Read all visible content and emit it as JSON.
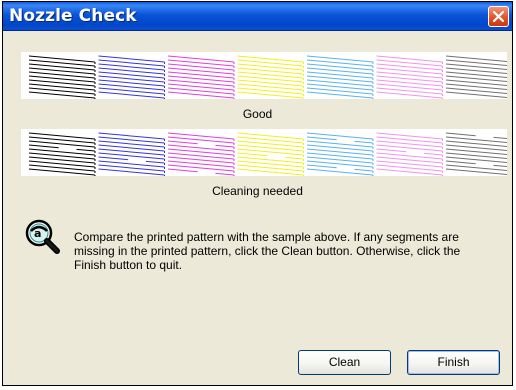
{
  "window": {
    "title": "Nozzle Check"
  },
  "patterns": {
    "good_label": "Good",
    "bad_label": "Cleaning needed",
    "colors": [
      "#000000",
      "#3434e0",
      "#e040d8",
      "#f0f020",
      "#5ab0f0",
      "#f094e8",
      "#707070"
    ]
  },
  "instructions": "Compare the printed pattern with the sample above. If any segments are missing in the printed pattern, click the Clean button. Otherwise, click the Finish button to quit.",
  "buttons": {
    "clean": "Clean",
    "finish": "Finish"
  },
  "icons": {
    "close": "close-icon",
    "info": "magnifier-info-icon"
  }
}
